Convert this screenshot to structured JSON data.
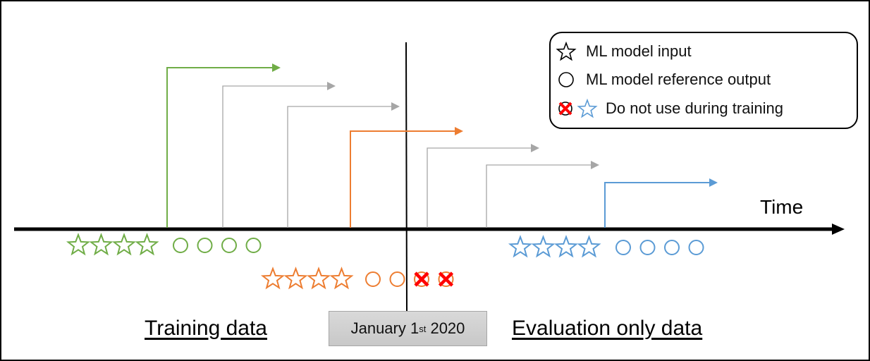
{
  "legend": {
    "items": [
      {
        "symbol": "star",
        "color": "#000000",
        "label": "ML model input"
      },
      {
        "symbol": "circle",
        "color": "#000000",
        "label": "ML model reference output"
      },
      {
        "symbol": "crossed-circle-and-blue-star",
        "color": "#5b9bd5",
        "label": "Do not use during training"
      }
    ]
  },
  "axis": {
    "label": "Time"
  },
  "cutoff": {
    "month_day": "January 1",
    "suffix": "st",
    "year": " 2020"
  },
  "captions": {
    "training": "Training data",
    "evaluation": "Evaluation only data"
  },
  "colors": {
    "training": "#70ad47",
    "straddling": "#ed7d31",
    "evaluation": "#5b9bd5",
    "other_windows": "#a6a6a6",
    "excluded_mark": "#ff0000"
  },
  "windows": [
    {
      "id": "training-window",
      "color_key": "training"
    },
    {
      "id": "window-2",
      "color_key": "other_windows"
    },
    {
      "id": "window-3",
      "color_key": "other_windows"
    },
    {
      "id": "straddling-window",
      "color_key": "straddling"
    },
    {
      "id": "window-5",
      "color_key": "other_windows"
    },
    {
      "id": "window-6",
      "color_key": "other_windows"
    },
    {
      "id": "evaluation-window",
      "color_key": "evaluation"
    }
  ],
  "sample_groups": [
    {
      "id": "training-samples",
      "color_key": "training",
      "inputs": 4,
      "outputs": 4,
      "excluded_outputs": 0
    },
    {
      "id": "straddling-samples",
      "color_key": "straddling",
      "inputs": 4,
      "outputs": 4,
      "excluded_outputs": 2
    },
    {
      "id": "evaluation-samples",
      "color_key": "evaluation",
      "inputs": 4,
      "outputs": 4,
      "excluded_outputs": 0
    }
  ]
}
